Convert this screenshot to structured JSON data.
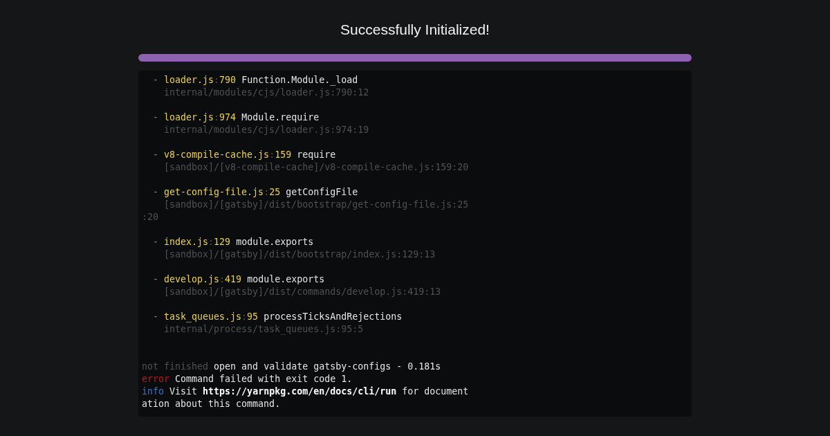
{
  "title": "Successfully Initialized!",
  "progress": {
    "level": 1
  },
  "frames": [
    {
      "bullet": "-",
      "source": "loader.js:790",
      "fn": "Function.Module._load",
      "location": [
        "internal/modules/cjs/loader.js:790:12"
      ]
    },
    {
      "bullet": "-",
      "source": "loader.js:974",
      "fn": "Module.require",
      "location": [
        "internal/modules/cjs/loader.js:974:19"
      ]
    },
    {
      "bullet": "-",
      "source": "v8-compile-cache.js:159",
      "fn": "require",
      "location": [
        "[sandbox]/[v8-compile-cache]/v8-compile-cache.js:159:20"
      ]
    },
    {
      "bullet": "-",
      "source": "get-config-file.js:25",
      "fn": "getConfigFile",
      "location": [
        "[sandbox]/[gatsby]/dist/bootstrap/get-config-file.js:25",
        ":20"
      ]
    },
    {
      "bullet": "-",
      "source": "index.js:129",
      "fn": "module.exports",
      "location": [
        "[sandbox]/[gatsby]/dist/bootstrap/index.js:129:13"
      ]
    },
    {
      "bullet": "-",
      "source": "develop.js:419",
      "fn": "module.exports",
      "location": [
        "[sandbox]/[gatsby]/dist/commands/develop.js:419:13"
      ]
    },
    {
      "bullet": "-",
      "source": "task_queues.js:95",
      "fn": "processTicksAndRejections",
      "location": [
        "internal/process/task_queues.js:95:5"
      ]
    }
  ],
  "summary": [
    {
      "kind": "status",
      "tag": "not finished",
      "lines": [
        "open and validate gatsby-configs - 0.181s"
      ]
    },
    {
      "kind": "error",
      "tag": "error",
      "lines": [
        "Command failed with exit code 1."
      ]
    },
    {
      "kind": "info",
      "tag": "info",
      "lines": [
        "Visit **https://yarnpkg.com/en/docs/cli/run** for document",
        "ation about this command."
      ]
    }
  ]
}
